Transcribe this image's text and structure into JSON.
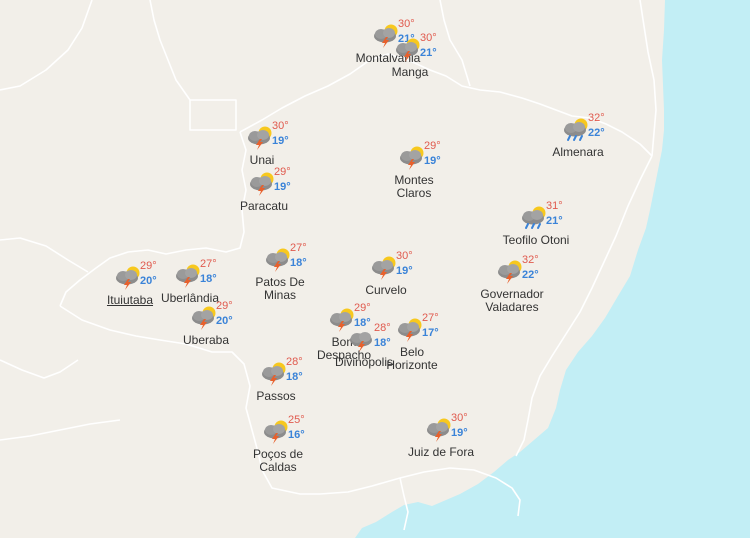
{
  "colors": {
    "land": "#f2efe9",
    "sea": "#c2eef5",
    "border": "#ffffff",
    "temp_max": "#e05a4e",
    "temp_min": "#3a83d8"
  },
  "cities": [
    {
      "id": "montalvania",
      "name": [
        "Montalvânia"
      ],
      "max": "30°",
      "min": "21°",
      "icon": "storm-sun-icon"
    },
    {
      "id": "manga",
      "name": [
        "Manga"
      ],
      "max": "30°",
      "min": "21°",
      "icon": "storm-sun-icon"
    },
    {
      "id": "unai",
      "name": [
        "Unai"
      ],
      "max": "30°",
      "min": "19°",
      "icon": "storm-sun-icon"
    },
    {
      "id": "paracatu",
      "name": [
        "Paracatu"
      ],
      "max": "29°",
      "min": "19°",
      "icon": "storm-sun-icon"
    },
    {
      "id": "montes-claros",
      "name": [
        "Montes",
        "Claros"
      ],
      "max": "29°",
      "min": "19°",
      "icon": "storm-sun-icon"
    },
    {
      "id": "almenara",
      "name": [
        "Almenara"
      ],
      "max": "32°",
      "min": "22°",
      "icon": "rain-sun-icon"
    },
    {
      "id": "teofilo-otoni",
      "name": [
        "Teofilo Otoni"
      ],
      "max": "31°",
      "min": "21°",
      "icon": "rain-sun-icon"
    },
    {
      "id": "patos-de-minas",
      "name": [
        "Patos De",
        "Minas"
      ],
      "max": "27°",
      "min": "18°",
      "icon": "storm-sun-icon"
    },
    {
      "id": "curvelo",
      "name": [
        "Curvelo"
      ],
      "max": "30°",
      "min": "19°",
      "icon": "storm-sun-icon"
    },
    {
      "id": "governador-valadares",
      "name": [
        "Governador",
        "Valadares"
      ],
      "max": "32°",
      "min": "22°",
      "icon": "storm-sun-icon"
    },
    {
      "id": "ituiutaba",
      "name": [
        "Ituiutaba"
      ],
      "max": "29°",
      "min": "20°",
      "icon": "storm-sun-icon",
      "underline": true
    },
    {
      "id": "uberlandia",
      "name": [
        "Uberlândia"
      ],
      "max": "27°",
      "min": "18°",
      "icon": "storm-sun-icon"
    },
    {
      "id": "uberaba",
      "name": [
        "Uberaba"
      ],
      "max": "29°",
      "min": "20°",
      "icon": "storm-sun-icon"
    },
    {
      "id": "bom-despacho",
      "name": [
        "Bom",
        "Despacho"
      ],
      "max": "29°",
      "min": "18°",
      "icon": "storm-sun-icon"
    },
    {
      "id": "divinopolis",
      "name": [
        "Divinópolis"
      ],
      "max": "28°",
      "min": "18°",
      "icon": "storm-icon"
    },
    {
      "id": "belo-horizonte",
      "name": [
        "Belo",
        "Horizonte"
      ],
      "max": "27°",
      "min": "17°",
      "icon": "storm-sun-icon"
    },
    {
      "id": "passos",
      "name": [
        "Passos"
      ],
      "max": "28°",
      "min": "18°",
      "icon": "storm-sun-icon"
    },
    {
      "id": "pocos-de-caldas",
      "name": [
        "Poços de",
        "Caldas"
      ],
      "max": "25°",
      "min": "16°",
      "icon": "storm-sun-icon"
    },
    {
      "id": "juiz-de-fora",
      "name": [
        "Juiz de Fora"
      ],
      "max": "30°",
      "min": "19°",
      "icon": "storm-sun-icon"
    }
  ]
}
